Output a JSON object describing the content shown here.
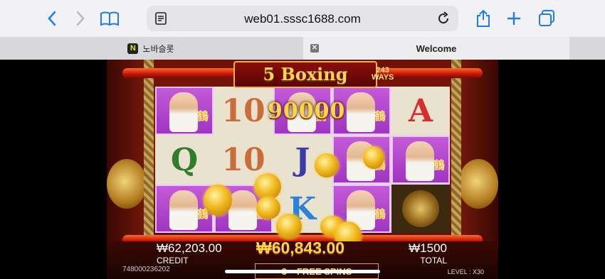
{
  "browser": {
    "url": "web01.sssc1688.com",
    "tabs": [
      {
        "badge": "N",
        "label": "노바슬롯"
      },
      {
        "label": "Welcome"
      }
    ],
    "icons": [
      "back-icon",
      "forward-icon",
      "bookmarks-icon",
      "reader-icon",
      "reload-icon",
      "share-icon",
      "new-tab-icon",
      "tabs-icon"
    ]
  },
  "game": {
    "title": "5 Boxing",
    "ways_number": "243",
    "ways_label": "WAYS",
    "win_popup": "90000",
    "reels": [
      [
        "boxer",
        "Q",
        "boxer"
      ],
      [
        "10",
        "10",
        "boxer"
      ],
      [
        "boxer",
        "J",
        "K"
      ],
      [
        "boxer",
        "boxer",
        "boxer"
      ],
      [
        "A",
        "boxer",
        "gong"
      ]
    ],
    "boxer_glyph": "鶴",
    "credit_value": "₩62,203.00",
    "credit_label": "CREDIT",
    "win_amount": "₩60,843.00",
    "total_value": "₩1500",
    "total_label": "TOTAL",
    "serial": "748000236202",
    "free_spins_count": "3",
    "free_spins_label": "FREE SPINS",
    "level_label": "LEVEL",
    "level_value": "X30"
  }
}
